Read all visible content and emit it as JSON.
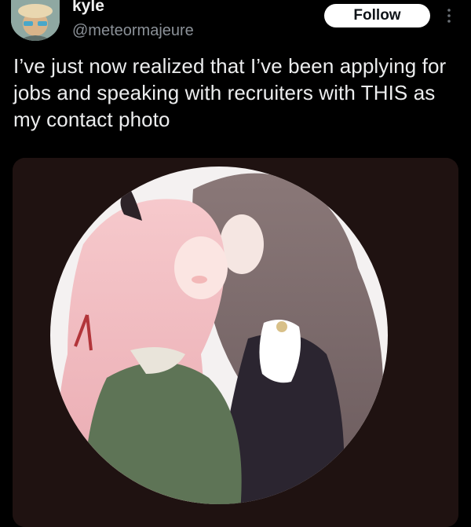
{
  "author": {
    "display_name": "kyle",
    "handle": "@meteormajeure",
    "avatar_icon": "profile-avatar"
  },
  "actions": {
    "follow_label": "Follow",
    "more_icon": "more-vertical-icon"
  },
  "tweet": {
    "text": "I’ve just now realized that I’ve been applying for jobs and speaking with recruiters with THIS as my contact photo"
  },
  "media": {
    "kind": "circular illustration image",
    "background_color": "#1f1211"
  },
  "colors": {
    "background": "#000000",
    "text_primary": "#ecedee",
    "text_secondary": "#8b9198",
    "button_bg": "#ffffff",
    "button_text": "#0f1419"
  }
}
